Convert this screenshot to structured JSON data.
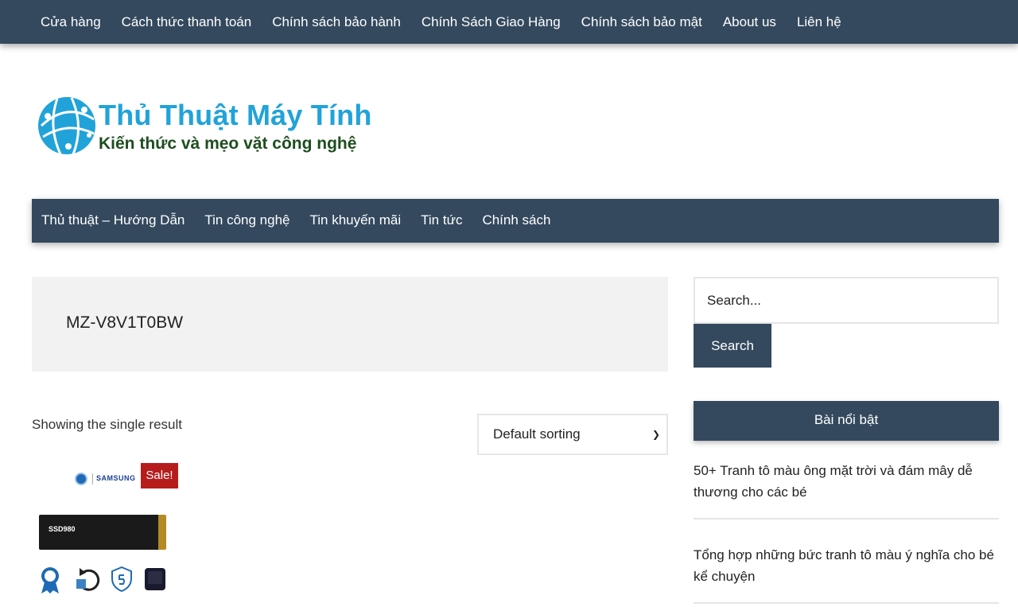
{
  "top_menu": {
    "items": [
      {
        "label": "Cửa hàng"
      },
      {
        "label": "Cách thức thanh toán"
      },
      {
        "label": "Chính sách bảo hành"
      },
      {
        "label": "Chính Sách Giao Hàng"
      },
      {
        "label": "Chính sách bảo mật"
      },
      {
        "label": "About us"
      },
      {
        "label": "Liên hệ"
      }
    ]
  },
  "logo": {
    "title": "Thủ Thuật Máy Tính",
    "tagline": "Kiến thức và mẹo vặt công nghệ"
  },
  "main_nav": {
    "items": [
      {
        "label": "Thủ thuật – Hướng Dẫn"
      },
      {
        "label": "Tin công nghệ"
      },
      {
        "label": "Tin khuyến mãi"
      },
      {
        "label": "Tin tức"
      },
      {
        "label": "Chính sách"
      }
    ]
  },
  "page": {
    "title": "MZ-V8V1T0BW",
    "result_count": "Showing the single result",
    "sort_selected": "Default sorting"
  },
  "product": {
    "brand_text": "SAMSUNG",
    "sale_label": "Sale!",
    "ssd_label": "SSD980"
  },
  "sidebar": {
    "search_placeholder": "Search...",
    "search_button": "Search",
    "featured_title": "Bài nổi bật",
    "posts": [
      {
        "title": "50+ Tranh tô màu ông mặt trời và đám mây dễ thương cho các bé"
      },
      {
        "title": "Tổng hợp những bức tranh tô màu ý nghĩa cho bé kể chuyện"
      }
    ]
  },
  "colors": {
    "nav_bg": "#34495e",
    "logo_blue": "#21a3d9",
    "logo_green": "#1e4d1f",
    "sale_red": "#b71c1c"
  }
}
